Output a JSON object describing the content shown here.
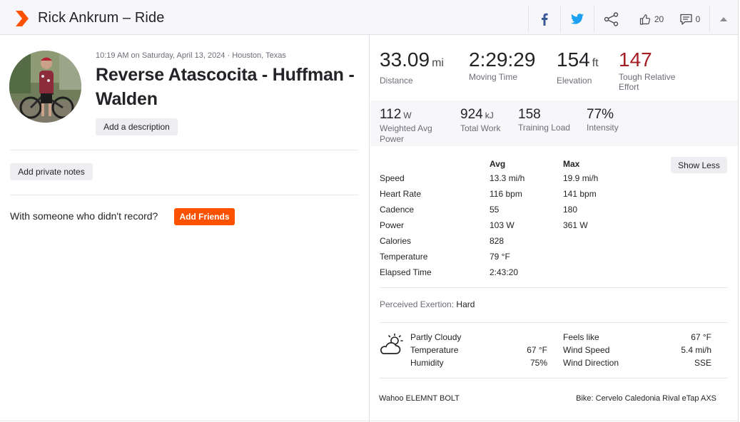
{
  "header": {
    "title": "Rick Ankrum – Ride",
    "kudos_count": "20",
    "comment_count": "0"
  },
  "activity": {
    "meta": "10:19 AM on Saturday, April 13, 2024 · Houston, Texas",
    "name": "Reverse Atascocita - Huffman - Walden",
    "add_description": "Add a description",
    "add_private_notes": "Add private notes",
    "with_someone": "With someone who didn't record?",
    "add_friends": "Add Friends"
  },
  "primary_stats": [
    {
      "value": "33.09",
      "unit": "mi",
      "label": "Distance"
    },
    {
      "value": "2:29:29",
      "unit": "",
      "label": "Moving Time"
    },
    {
      "value": "154",
      "unit": "ft",
      "label": "Elevation"
    },
    {
      "value": "147",
      "unit": "",
      "label": "Tough Relative Effort"
    }
  ],
  "secondary_stats": [
    {
      "value": "112",
      "unit": "W",
      "label": "Weighted Avg Power"
    },
    {
      "value": "924",
      "unit": "kJ",
      "label": "Total Work"
    },
    {
      "value": "158",
      "unit": "",
      "label": "Training Load"
    },
    {
      "value": "77%",
      "unit": "",
      "label": "Intensity"
    }
  ],
  "stats_table": {
    "avg_header": "Avg",
    "max_header": "Max",
    "show_less": "Show Less",
    "rows": [
      {
        "label": "Speed",
        "avg": "13.3 mi/h",
        "max": "19.9 mi/h"
      },
      {
        "label": "Heart Rate",
        "avg": "116 bpm",
        "max": "141 bpm"
      },
      {
        "label": "Cadence",
        "avg": "55",
        "max": "180"
      },
      {
        "label": "Power",
        "avg": "103 W",
        "max": "361 W"
      },
      {
        "label": "Calories",
        "avg": "828",
        "max": ""
      },
      {
        "label": "Temperature",
        "avg": "79 °F",
        "max": ""
      },
      {
        "label": "Elapsed Time",
        "avg": "2:43:20",
        "max": ""
      }
    ]
  },
  "perceived": {
    "label": "Perceived Exertion:",
    "value": "Hard"
  },
  "weather": {
    "condition": "Partly Cloudy",
    "temperature_label": "Temperature",
    "temperature_value": "67 °F",
    "humidity_label": "Humidity",
    "humidity_value": "75%",
    "feels_like_label": "Feels like",
    "feels_like_value": "67 °F",
    "wind_speed_label": "Wind Speed",
    "wind_speed_value": "5.4 mi/h",
    "wind_direction_label": "Wind Direction",
    "wind_direction_value": "SSE"
  },
  "gear": {
    "device": "Wahoo ELEMNT BOLT",
    "bike": "Bike: Cervelo Caledonia Rival eTap AXS"
  },
  "colors": {
    "brand_orange": "#fc5200",
    "effort_red": "#a51e24",
    "facebook_blue": "#3b5998",
    "twitter_blue": "#1da1f2"
  }
}
